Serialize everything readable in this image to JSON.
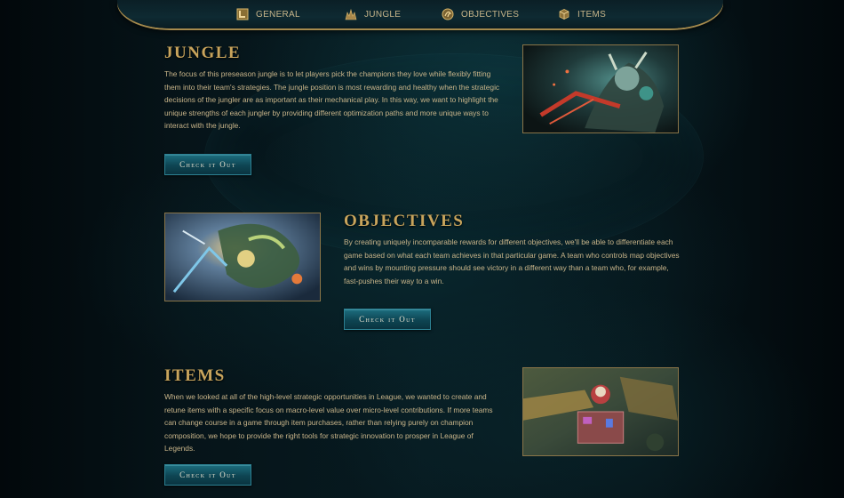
{
  "nav": {
    "items": [
      {
        "label": "GENERAL",
        "icon": "general-icon"
      },
      {
        "label": "JUNGLE",
        "icon": "jungle-icon"
      },
      {
        "label": "OBJECTIVES",
        "icon": "objectives-icon"
      },
      {
        "label": "ITEMS",
        "icon": "items-icon"
      }
    ]
  },
  "sections": {
    "jungle": {
      "title": "JUNGLE",
      "text": "The focus of this preseason jungle is to let players pick the champions they love while flexibly fitting them into their team's strategies. The jungle position is most rewarding and healthy when the strategic decisions of the jungler are as important as their mechanical play. In this way, we want to highlight the unique strengths of each jungler by providing different optimization paths and more unique ways to interact with the jungle.",
      "button": "Check it Out",
      "image": "jungle-champion-splash-art"
    },
    "objectives": {
      "title": "OBJECTIVES",
      "text": "By creating uniquely incomparable rewards for different objectives, we'll be able to differentiate each game based on what each team achieves in that particular game. A team who controls map objectives and wins by mounting pressure should see victory in a different way than a team who, for example, fast-pushes their way to a win.",
      "button": "Check it Out",
      "image": "objectives-dragon-splash-art"
    },
    "items": {
      "title": "ITEMS",
      "text": "When we looked at all of the high-level strategic opportunities in League, we wanted to create and retune items with a specific focus on macro-level value over micro-level contributions. If more teams can change course in a game through item purchases, rather than relying purely on champion composition, we hope to provide the right tools for strategic innovation to prosper in League of Legends.",
      "button": "Check it Out",
      "image": "item-shop-splash-art"
    }
  },
  "colors": {
    "gold": "#c8a45c",
    "text": "#c9b58a",
    "button": "#0e4553",
    "background": "#040d12"
  }
}
